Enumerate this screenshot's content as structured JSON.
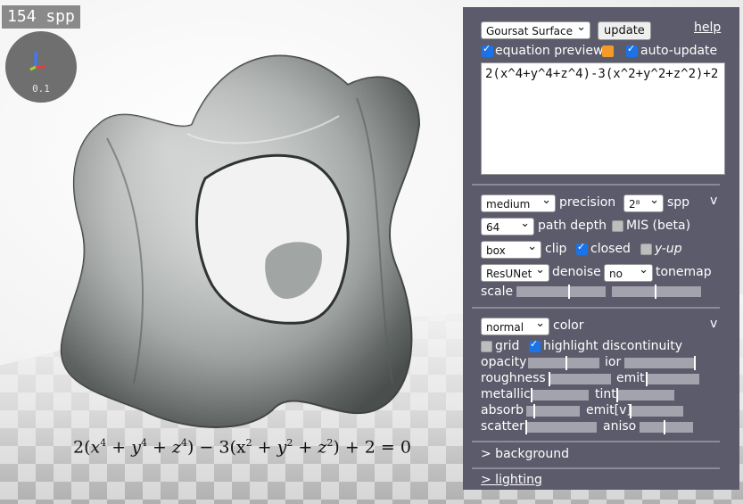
{
  "viewport": {
    "spp_label": "154 spp",
    "axes_scale": "0.1",
    "equation_display": {
      "a": "2(",
      "b": "x",
      "c": "4",
      "d": " + y",
      "e": "4",
      "f": " + z",
      "g": "4",
      "h": ") − 3(x",
      "i": "2",
      "j": " + y",
      "k": "2",
      "l": " + z",
      "m": "2",
      "n": ") + 2 = 0"
    }
  },
  "panel": {
    "preset_select": "Goursat Surface",
    "update_button": "update",
    "help_link": "help",
    "equation_preview_label": "equation preview",
    "auto_update_label": "auto-update",
    "equation_text": "2(x^4+y^4+z^4)-3(x^2+y^2+z^2)+2",
    "render": {
      "precision_select": "medium",
      "precision_label": "precision",
      "spp_select": "2⁸",
      "spp_label": "spp",
      "collapse": "v",
      "path_depth_select": "64",
      "path_depth_label": "path depth",
      "mis_label": "MIS (beta)",
      "clip_select": "box",
      "clip_label": "clip",
      "closed_label": "closed",
      "yup_label": "y-up",
      "denoise_select": "ResUNet",
      "denoise_label": "denoise",
      "tonemap_select": "no",
      "tonemap_label": "tonemap",
      "scale_label": "scale"
    },
    "material": {
      "color_select": "normal",
      "color_label": "color",
      "collapse": "v",
      "grid_label": "grid",
      "highlight_label": "highlight discontinuity",
      "opacity_label": "opacity",
      "ior_label": "ior",
      "roughness_label": "roughness",
      "emit_label": "emit",
      "metallic_label": "metallic",
      "tint_label": "tint",
      "absorb_label": "absorb",
      "emitv_label": "emit[v]",
      "scatter_label": "scatter",
      "aniso_label": "aniso"
    },
    "background_link": "> background",
    "lighting_link": "> lighting"
  }
}
